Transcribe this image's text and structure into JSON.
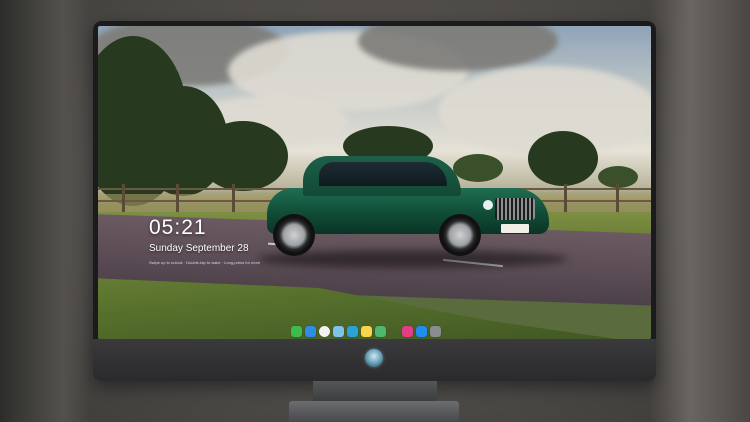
{
  "lockscreen": {
    "time": "05:21",
    "date": "Sunday September  28",
    "hint": "Swipe up to unlock · Double-tap to wake · Long-press for more"
  },
  "dock": {
    "apps": [
      {
        "name": "messages-icon",
        "color": "#3bbd4b"
      },
      {
        "name": "mail-icon",
        "color": "#2f8de4"
      },
      {
        "name": "clock-icon",
        "color": "#f2f2f2"
      },
      {
        "name": "photos-icon",
        "color": "#7fc4e8"
      },
      {
        "name": "clips-icon",
        "color": "#2aa2d8"
      },
      {
        "name": "notes-icon",
        "color": "#f7d44a"
      },
      {
        "name": "facetime-icon",
        "color": "#4cb870"
      },
      {
        "name": "music-icon",
        "color": "#e13e86"
      },
      {
        "name": "app-store-icon",
        "color": "#1f8ef1"
      },
      {
        "name": "camera-icon",
        "color": "#8a8c90"
      }
    ]
  },
  "wallpaper": {
    "plate": "W30 BKL"
  }
}
